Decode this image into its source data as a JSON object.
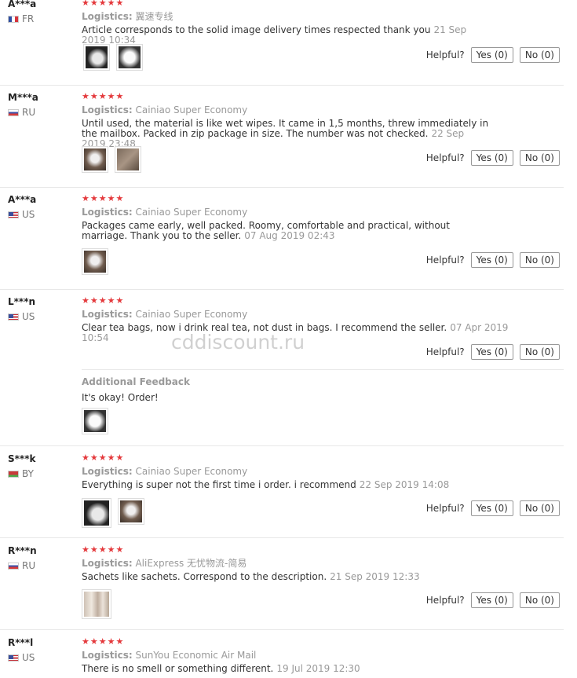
{
  "labels": {
    "logistics": "Logistics:",
    "helpful": "Helpful?",
    "additional_feedback": "Additional Feedback",
    "stars": "★★★★★"
  },
  "watermark": "cddiscount.ru",
  "reviews": [
    {
      "user": "A***a",
      "country": "FR",
      "logistics": "翼速专线",
      "text": "Article corresponds to the solid image delivery times respected thank you",
      "date": "21 Sep 2019 10:34",
      "yes": "Yes (0)",
      "no": "No (0)"
    },
    {
      "user": "M***a",
      "country": "RU",
      "logistics": "Cainiao Super Economy",
      "text": "Until used, the material is like wet wipes. It came in 1,5 months, threw immediately in the mailbox. Packed in zip package in size. The number was not checked.",
      "date": "22 Sep 2019 23:48",
      "yes": "Yes (0)",
      "no": "No (0)"
    },
    {
      "user": "A***a",
      "country": "US",
      "logistics": "Cainiao Super Economy",
      "text": "Packages came early, well packed. Roomy, comfortable and practical, without marriage. Thank you to the seller.",
      "date": "07 Aug 2019 02:43",
      "yes": "Yes (0)",
      "no": "No (0)"
    },
    {
      "user": "L***n",
      "country": "US",
      "logistics": "Cainiao Super Economy",
      "text": "Clear tea bags, now i drink real tea, not dust in bags. I recommend the seller.",
      "date": "07 Apr 2019 10:54",
      "yes": "Yes (0)",
      "no": "No (0)",
      "additional": "It's okay! Order!"
    },
    {
      "user": "S***k",
      "country": "BY",
      "logistics": "Cainiao Super Economy",
      "text": "Everything is super not the first time i order. i recommend",
      "date": "22 Sep 2019 14:08",
      "yes": "Yes (0)",
      "no": "No (0)"
    },
    {
      "user": "R***n",
      "country": "RU",
      "logistics": "AliExpress 无忧物流-简易",
      "text": "Sachets like sachets. Correspond to the description.",
      "date": "21 Sep 2019 12:33",
      "yes": "Yes (0)",
      "no": "No (0)"
    },
    {
      "user": "R***l",
      "country": "US",
      "logistics": "SunYou Economic Air Mail",
      "text": "There is no smell or something different.",
      "date": "19 Jul 2019 12:30"
    }
  ]
}
